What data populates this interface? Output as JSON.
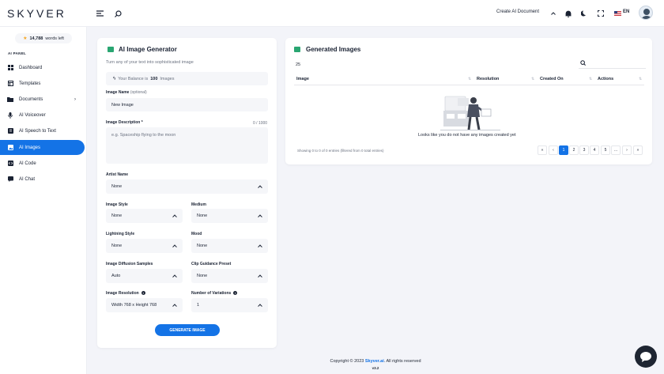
{
  "topbar": {
    "logo": "SKYVER",
    "create_label": "Create AI Document",
    "lang": "EN"
  },
  "sidebar": {
    "credits_count": "14,788",
    "credits_label": "words left",
    "panel_label": "AI PANEL",
    "items": [
      {
        "label": "Dashboard",
        "icon": "grid-icon"
      },
      {
        "label": "Templates",
        "icon": "template-icon"
      },
      {
        "label": "Documents",
        "icon": "folder-icon"
      },
      {
        "label": "AI Voiceover",
        "icon": "microphone-icon"
      },
      {
        "label": "AI Speech to Text",
        "icon": "speech-icon"
      },
      {
        "label": "AI Images",
        "icon": "image-icon"
      },
      {
        "label": "AI Code",
        "icon": "code-icon"
      },
      {
        "label": "AI Chat",
        "icon": "chat-icon"
      }
    ]
  },
  "generator": {
    "title": "AI Image Generator",
    "subtitle": "Turn any of your text into sophisticated image",
    "balance_label": "Your Balance is",
    "balance_value": "100",
    "balance_unit": "Images",
    "name_label": "Image Name",
    "name_optional": "(optional)",
    "name_value": "New Image",
    "desc_label": "Image Description *",
    "desc_counter": "0 / 1000",
    "desc_placeholder": "e.g. Spaceship flying to the moon",
    "artist_label": "Artist Name",
    "artist_value": "None",
    "style_label": "Image Style",
    "style_value": "None",
    "medium_label": "Medium",
    "medium_value": "None",
    "lighting_label": "Lightning Style",
    "lighting_value": "None",
    "mood_label": "Mood",
    "mood_value": "None",
    "diffusion_label": "Image Diffusion Samples",
    "diffusion_value": "Auto",
    "clip_label": "Clip Guidance Preset",
    "clip_value": "None",
    "resolution_label": "Image Resolution",
    "resolution_value": "Width 768 x Height 768",
    "variations_label": "Number of Variations",
    "variations_value": "1",
    "generate_button": "GENERATE IMAGE"
  },
  "generated": {
    "title": "Generated Images",
    "page_size": "25",
    "columns": [
      "Image",
      "Resolution",
      "Created On",
      "Actions"
    ],
    "empty_text": "Looks like you do not have any images created yet",
    "info": "Showing 0 to 0 of 0 entries (filtered from 0 total entries)",
    "pages": [
      "«",
      "‹",
      "1",
      "2",
      "3",
      "4",
      "5",
      "…",
      "›",
      "»"
    ]
  },
  "footer": {
    "copyright_prefix": "Copyright © 2023",
    "brand": "Skyver.ai",
    "copyright_suffix": ". All rights reserved",
    "version": "v3.2"
  },
  "colors": {
    "accent": "#1473e6",
    "green_icon": "#2aa672"
  }
}
